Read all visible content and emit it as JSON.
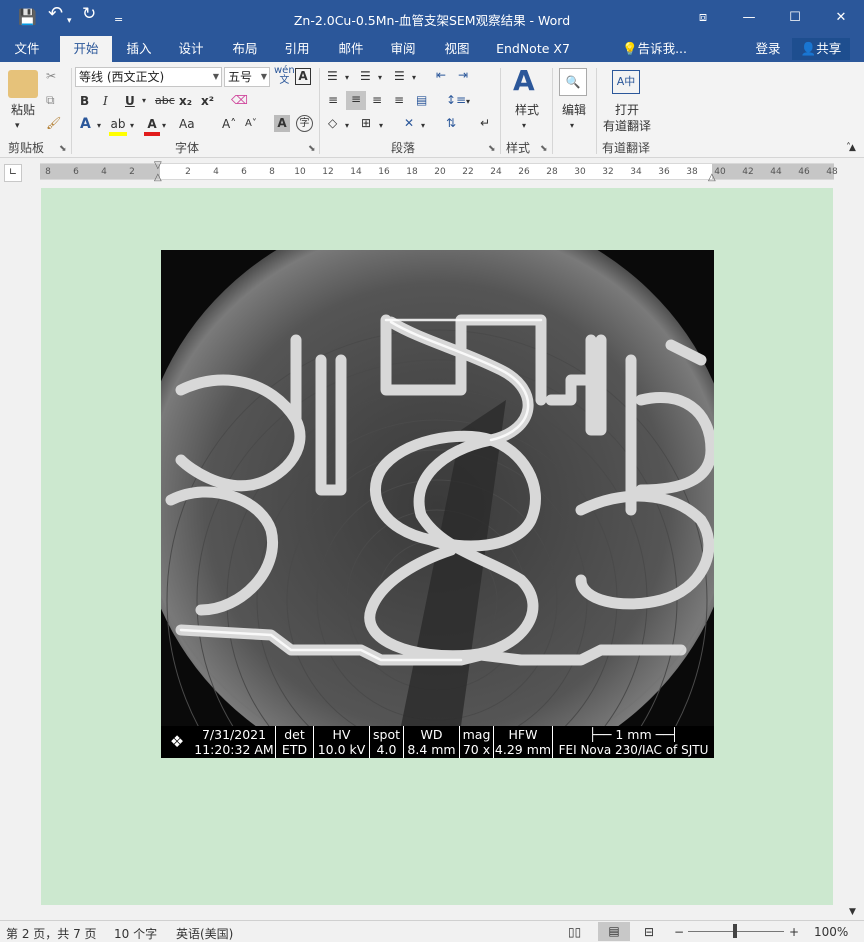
{
  "window": {
    "title": "Zn-2.0Cu-0.5Mn-血管支架SEM观察结果 - Word",
    "quick_access": {
      "save_icon": "💾",
      "undo_icon": "↶",
      "redo_icon": "↻",
      "customize_icon": "="
    },
    "controls": {
      "ribbon_display": "⧈",
      "minimize": "—",
      "maximize": "☐",
      "close": "✕"
    }
  },
  "tabs": [
    {
      "label": "文件"
    },
    {
      "label": "开始"
    },
    {
      "label": "插入"
    },
    {
      "label": "设计"
    },
    {
      "label": "布局"
    },
    {
      "label": "引用"
    },
    {
      "label": "邮件"
    },
    {
      "label": "审阅"
    },
    {
      "label": "视图"
    },
    {
      "label": "EndNote X7"
    }
  ],
  "tell_me": "告诉我...",
  "sign_in": "登录",
  "share": "共享",
  "ribbon": {
    "clipboard": {
      "paste": "粘贴",
      "label": "剪贴板"
    },
    "font": {
      "font_name": "等线 (西文正文)",
      "font_size": "五号",
      "label": "字体",
      "bold": "B",
      "italic": "I",
      "underline": "U",
      "strike": "abc",
      "subscript": "x₂",
      "superscript": "x²",
      "grow": "A˄",
      "shrink": "A˅",
      "case": "Aa",
      "phonetic": "wén",
      "border_char": "A"
    },
    "paragraph": {
      "label": "段落"
    },
    "styles": {
      "button": "样式",
      "label": "样式"
    },
    "editing": {
      "button": "编辑"
    },
    "translate": {
      "button_line1": "打开",
      "button_line2": "有道翻译",
      "label": "有道翻译"
    }
  },
  "ruler": {
    "left_ticks": [
      "8",
      "6",
      "4",
      "2"
    ],
    "right_ticks": [
      "2",
      "4",
      "6",
      "8",
      "10",
      "12",
      "14",
      "16",
      "18",
      "20",
      "22",
      "24",
      "26",
      "28",
      "30",
      "32",
      "34",
      "36",
      "38",
      "40",
      "42",
      "44",
      "46",
      "48"
    ]
  },
  "sem_image": {
    "databar": {
      "date": "7/31/2021",
      "time": "11:20:32 AM",
      "det_label": "det",
      "det_value": "ETD",
      "hv_label": "HV",
      "hv_value": "10.0 kV",
      "spot_label": "spot",
      "spot_value": "4.0",
      "wd_label": "WD",
      "wd_value": "8.4 mm",
      "mag_label": "mag",
      "mag_value": "70 x",
      "hfw_label": "HFW",
      "hfw_value": "4.29 mm",
      "scale_label": "1 mm",
      "instrument": "FEI Nova 230/IAC of SJTU"
    }
  },
  "status": {
    "page": "第 2 页，共 7 页",
    "words": "10 个字",
    "language": "英语(美国)",
    "zoom": "100%"
  },
  "colors": {
    "accent": "#2b579a",
    "page_background": "#cce8cf"
  }
}
